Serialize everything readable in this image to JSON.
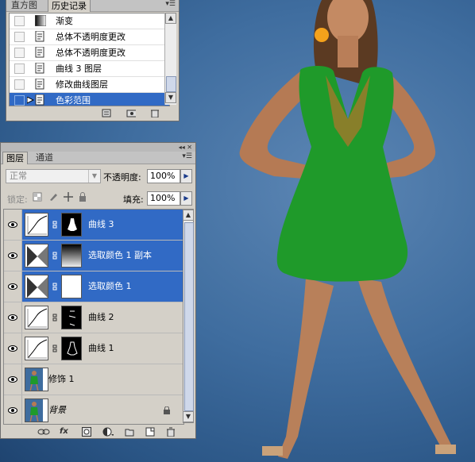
{
  "history_panel": {
    "tabs": [
      {
        "label": "直方图",
        "active": false
      },
      {
        "label": "历史记录",
        "active": true
      }
    ],
    "menu_icon": "panel-menu-icon",
    "items": [
      {
        "label": "渐变",
        "selected": false
      },
      {
        "label": "总体不透明度更改",
        "selected": false
      },
      {
        "label": "总体不透明度更改",
        "selected": false
      },
      {
        "label": "曲线 3 图层",
        "selected": false
      },
      {
        "label": "修改曲线图层",
        "selected": false
      },
      {
        "label": "色彩范围",
        "selected": true
      }
    ],
    "footer_icons": [
      "new-document-from-state-icon",
      "new-snapshot-icon",
      "delete-state-icon"
    ]
  },
  "layers_panel": {
    "tabs": [
      {
        "label": "图层",
        "active": true
      },
      {
        "label": "通道",
        "active": false
      }
    ],
    "blend_mode": "正常",
    "opacity_label": "不透明度:",
    "opacity_value": "100%",
    "lock_label": "锁定:",
    "fill_label": "填充:",
    "fill_value": "100%",
    "layers": [
      {
        "name": "曲线 3",
        "kind": "curves",
        "selected": true
      },
      {
        "name": "选取颜色 1 副本",
        "kind": "selective-color",
        "selected": true
      },
      {
        "name": "选取颜色 1",
        "kind": "selective-color",
        "selected": true
      },
      {
        "name": "曲线 2",
        "kind": "curves",
        "selected": false
      },
      {
        "name": "曲线 1",
        "kind": "curves",
        "selected": false
      },
      {
        "name": "修饰 1",
        "kind": "image",
        "selected": false
      },
      {
        "name": "背景",
        "kind": "image",
        "selected": false
      }
    ],
    "footer_icons": [
      "link-layers-icon",
      "fx-icon",
      "add-mask-icon",
      "adjustment-layer-icon",
      "new-group-icon",
      "new-layer-icon",
      "delete-layer-icon"
    ],
    "footer_glyphs": {
      "fx": "fx"
    }
  },
  "colors": {
    "selection": "#316ac5",
    "panel_bg": "#d4d0c8",
    "dress": "#1f9a2a",
    "background": "#3f6d9f",
    "callout": "#f5a21b"
  }
}
